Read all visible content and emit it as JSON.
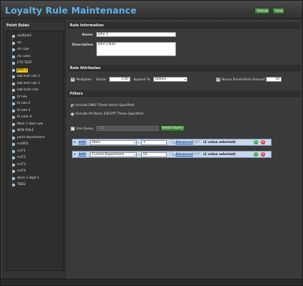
{
  "header": {
    "title": "Loyalty Rule Maintenance",
    "details_label": "Details",
    "save_label": "Save"
  },
  "left_panel": {
    "title": "Point Rules",
    "items": [
      "cpaRule1",
      "ctc",
      "ctc rule",
      "ctc rules",
      "CTV TEST",
      "John 1",
      "kab test rule 2",
      "kab test rule 3",
      "kab tools rule",
      "lit rule",
      "lit rule 2",
      "lit rule 3",
      "lit rules 4",
      "Mark 1 item rule",
      "NEW RULE",
      "paint department",
      "rcsl001",
      "rcsT1",
      "rcsT2",
      "rcsT3",
      "rcsT4",
      "store 1 dept 1",
      "TBD2"
    ],
    "selected": "John 1"
  },
  "rule_information": {
    "title": "Rule Information",
    "name_label": "Name",
    "name_value": "John 1",
    "description_label": "Description",
    "description_value": "John's Rule"
  },
  "rule_attributes": {
    "title": "Rule Attributes",
    "multiplier_label": "Multiplier",
    "factor_label": "Factor",
    "factor_value": "2.00",
    "applied_to_label": "Applied To",
    "applied_to_value": "Dollars",
    "bonus_points_label": "Bonus Points",
    "point_amount_label": "Point Amount",
    "point_amount_value": "50"
  },
  "filters": {
    "title": "Filters",
    "include_only_label": "Include ONLY Those Items Specified",
    "include_all_label": "Include All Items EXCEPT Those Specified",
    "use_query_label": "Use Query",
    "query_value": "1 Q",
    "select_query_label": "Select Query",
    "rows": [
      {
        "op": "AND",
        "field": "Store",
        "value": "1",
        "advanced": "Advanced",
        "state": "OFF",
        "count": "(1 value selected)"
      },
      {
        "op": "AND",
        "field": "Current Department",
        "value": "03",
        "advanced": "Advanced",
        "state": "OFF",
        "count": "(1 value selected)"
      }
    ]
  },
  "icons": {
    "add": "+",
    "remove": "×",
    "arrow": "▸",
    "down": "▾",
    "mag": "🔍"
  },
  "colors": {
    "title": "#5fb3e8",
    "selected": "#f0c419",
    "filter_row": "#c8d8ec"
  }
}
